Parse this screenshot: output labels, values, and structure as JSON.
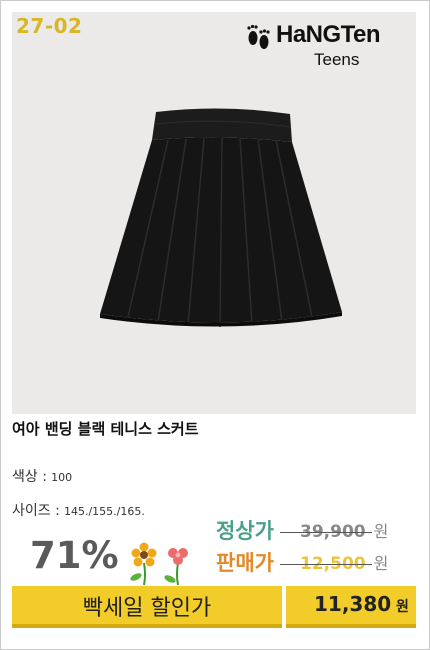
{
  "product_code": "27-02",
  "brand": {
    "name": "HaNGTen",
    "sub": "Teens",
    "logo_icon": "footprints-icon"
  },
  "product": {
    "title": "여아 밴딩 블랙 테니스 스커트",
    "color_label": "색상 :",
    "color_value": "100",
    "size_label": "사이즈 :",
    "size_value": "145./155./165."
  },
  "pricing": {
    "discount": "71%",
    "regular_label": "정상가",
    "regular_price": "39,900",
    "sale_label": "판매가",
    "sale_price": "12,500",
    "won": "원",
    "flash_sale_label": "빡세일 할인가",
    "final_price": "11,380",
    "final_won": "원"
  },
  "colors": {
    "accent_yellow": "#f2cc28",
    "code_gold": "#d9b628",
    "regular_label": "#4aa08a",
    "sale_label": "#e08a2a"
  }
}
